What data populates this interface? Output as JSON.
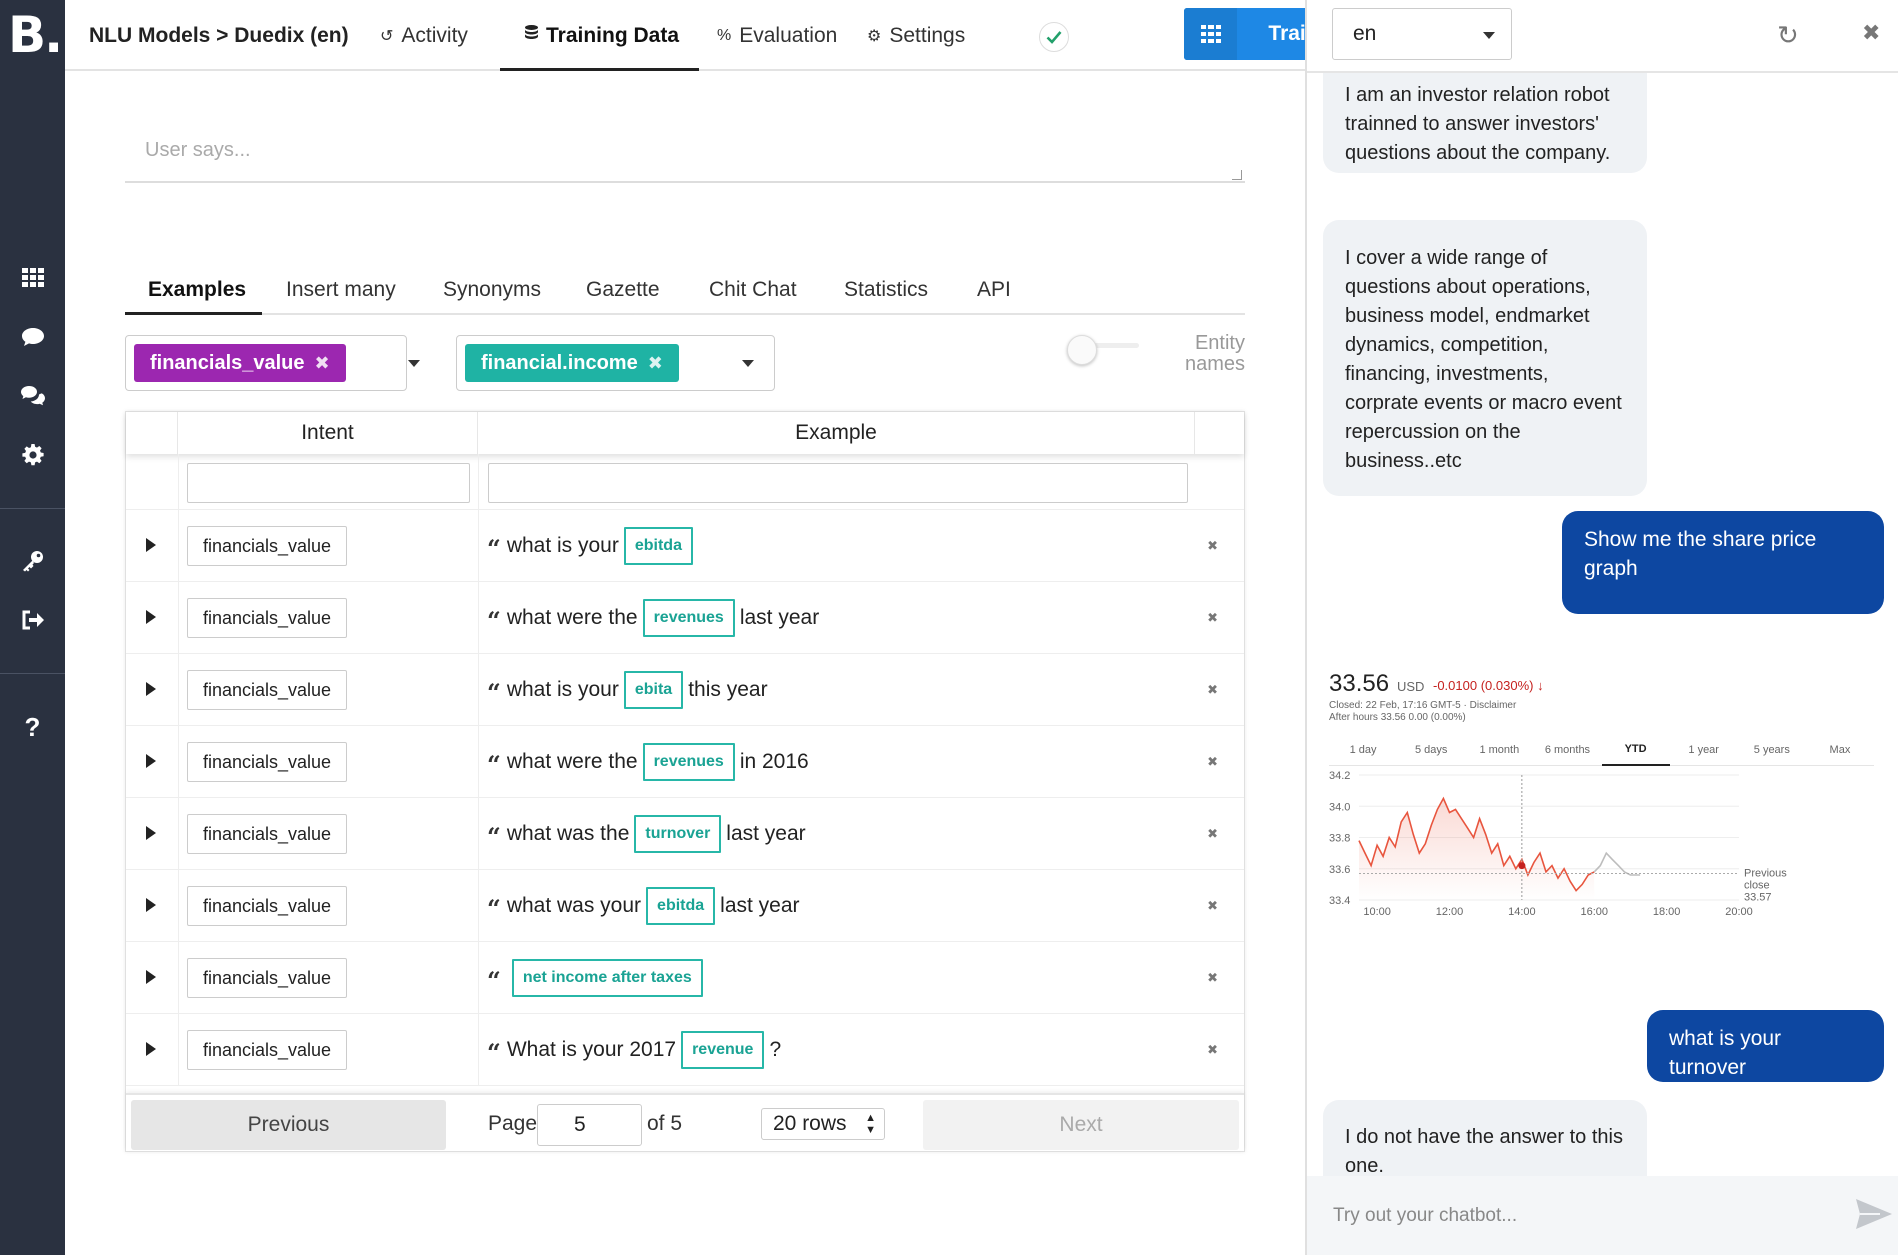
{
  "brand": {
    "logo": "B."
  },
  "leftnav": {
    "icons": [
      "grid-icon",
      "chat-bubble-icon",
      "chat-bubbles-icon",
      "gear-icon",
      "key-icon",
      "logout-icon",
      "help-icon"
    ]
  },
  "topbar": {
    "breadcrumb": "NLU Models > Duedix (en)",
    "nav": {
      "activity": "Activity",
      "training_data": "Training Data",
      "evaluation": "Evaluation",
      "settings": "Settings"
    },
    "train_label": "Train"
  },
  "user_says": {
    "placeholder": "User says..."
  },
  "subtabs": {
    "examples": "Examples",
    "insert_many": "Insert many",
    "synonyms": "Synonyms",
    "gazette": "Gazette",
    "chit_chat": "Chit Chat",
    "statistics": "Statistics",
    "api": "API"
  },
  "filters": {
    "intent_chip": "financials_value",
    "entity_chip": "financial.income",
    "entity_names_label": "Entity names"
  },
  "table": {
    "headers": {
      "intent": "Intent",
      "example": "Example"
    },
    "rows": [
      {
        "intent": "financials_value",
        "pre": "what is your",
        "entity": "ebitda",
        "post": ""
      },
      {
        "intent": "financials_value",
        "pre": "what were the",
        "entity": "revenues",
        "post": "last year"
      },
      {
        "intent": "financials_value",
        "pre": "what is your",
        "entity": "ebita",
        "post": "this year"
      },
      {
        "intent": "financials_value",
        "pre": "what were the",
        "entity": "revenues",
        "post": "in 2016"
      },
      {
        "intent": "financials_value",
        "pre": "what was the",
        "entity": "turnover",
        "post": "last year"
      },
      {
        "intent": "financials_value",
        "pre": "what was your",
        "entity": "ebitda",
        "post": "last year"
      },
      {
        "intent": "financials_value",
        "pre": "",
        "entity": "net income after taxes",
        "post": ""
      },
      {
        "intent": "financials_value",
        "pre": "What is your 2017",
        "entity": "revenue",
        "post": "?"
      }
    ],
    "pagination": {
      "previous": "Previous",
      "page_label": "Page",
      "page_value": "5",
      "of_label": "of 5",
      "rows_label": "20 rows",
      "next": "Next"
    }
  },
  "chat": {
    "language": "en",
    "messages": {
      "bot1": "I am an investor relation robot trainned to answer investors' questions about the company.",
      "bot2": "I cover a wide range of questions about operations, business model, endmarket dynamics, competition, financing, investments, corprate events or macro event repercussion on the business..etc",
      "user1": "Show me the share price graph",
      "user2": "what is your turnover",
      "bot3": "I do not have the answer to this one."
    },
    "input_placeholder": "Try out your chatbot..."
  },
  "stock_widget": {
    "price": "33.56",
    "currency": "USD",
    "change": "-0.0100 (0.030%) ↓",
    "closed_text": "Closed: 22 Feb, 17:16 GMT-5 · Disclaimer",
    "after_hours": "After hours 33.56 0.00 (0.00%)",
    "periods": [
      "1 day",
      "5 days",
      "1 month",
      "6 months",
      "YTD",
      "1 year",
      "5 years",
      "Max"
    ],
    "selected_period": "YTD",
    "previous_close_label": [
      "Previous",
      "close",
      "33.57"
    ]
  },
  "chart_data": {
    "type": "line",
    "title": "",
    "xlabel": "",
    "ylabel": "",
    "ylim": [
      33.4,
      34.2
    ],
    "xlim": [
      "09:30",
      "20:00"
    ],
    "y_ticks": [
      "34.2",
      "34.0",
      "33.8",
      "33.6",
      "33.4"
    ],
    "x_ticks": [
      "10:00",
      "12:00",
      "14:00",
      "16:00",
      "18:00",
      "20:00"
    ],
    "previous_close": 33.57,
    "series": [
      {
        "session": "regular",
        "color": "#e8553e",
        "x": [
          "09:30",
          "09:40",
          "09:50",
          "10:00",
          "10:10",
          "10:20",
          "10:30",
          "10:40",
          "10:50",
          "11:00",
          "11:10",
          "11:20",
          "11:30",
          "11:40",
          "11:50",
          "12:00",
          "12:10",
          "12:20",
          "12:30",
          "12:40",
          "12:50",
          "13:00",
          "13:10",
          "13:20",
          "13:30",
          "13:40",
          "13:50",
          "14:00",
          "14:10",
          "14:20",
          "14:30",
          "14:40",
          "14:50",
          "15:00",
          "15:10",
          "15:20",
          "15:30",
          "15:40",
          "15:50",
          "16:00"
        ],
        "y": [
          33.78,
          33.7,
          33.62,
          33.75,
          33.68,
          33.8,
          33.74,
          33.9,
          33.96,
          33.82,
          33.7,
          33.76,
          33.88,
          33.98,
          34.05,
          33.96,
          33.98,
          33.92,
          33.86,
          33.8,
          33.92,
          33.82,
          33.7,
          33.76,
          33.62,
          33.68,
          33.6,
          33.66,
          33.56,
          33.64,
          33.7,
          33.58,
          33.62,
          33.54,
          33.6,
          33.52,
          33.46,
          33.5,
          33.56,
          33.58
        ]
      },
      {
        "session": "after-hours",
        "color": "#bdbdbd",
        "x": [
          "16:00",
          "16:10",
          "16:20",
          "16:30",
          "16:40",
          "16:50",
          "17:00",
          "17:10",
          "17:16"
        ],
        "y": [
          33.58,
          33.62,
          33.7,
          33.66,
          33.62,
          33.58,
          33.56,
          33.56,
          33.56
        ]
      }
    ],
    "marker": {
      "x": "14:00",
      "y": 33.62
    }
  },
  "colors": {
    "nav_bg": "#2a3140",
    "train_blue": "#1e88e5",
    "intent_chip": "#9c27b0",
    "entity_chip": "#1fb3a4",
    "entity_border": "#27b7a8",
    "user_bubble": "#0d47a1",
    "bot_bubble": "#eff2f5",
    "stock_red": "#c5221f"
  }
}
